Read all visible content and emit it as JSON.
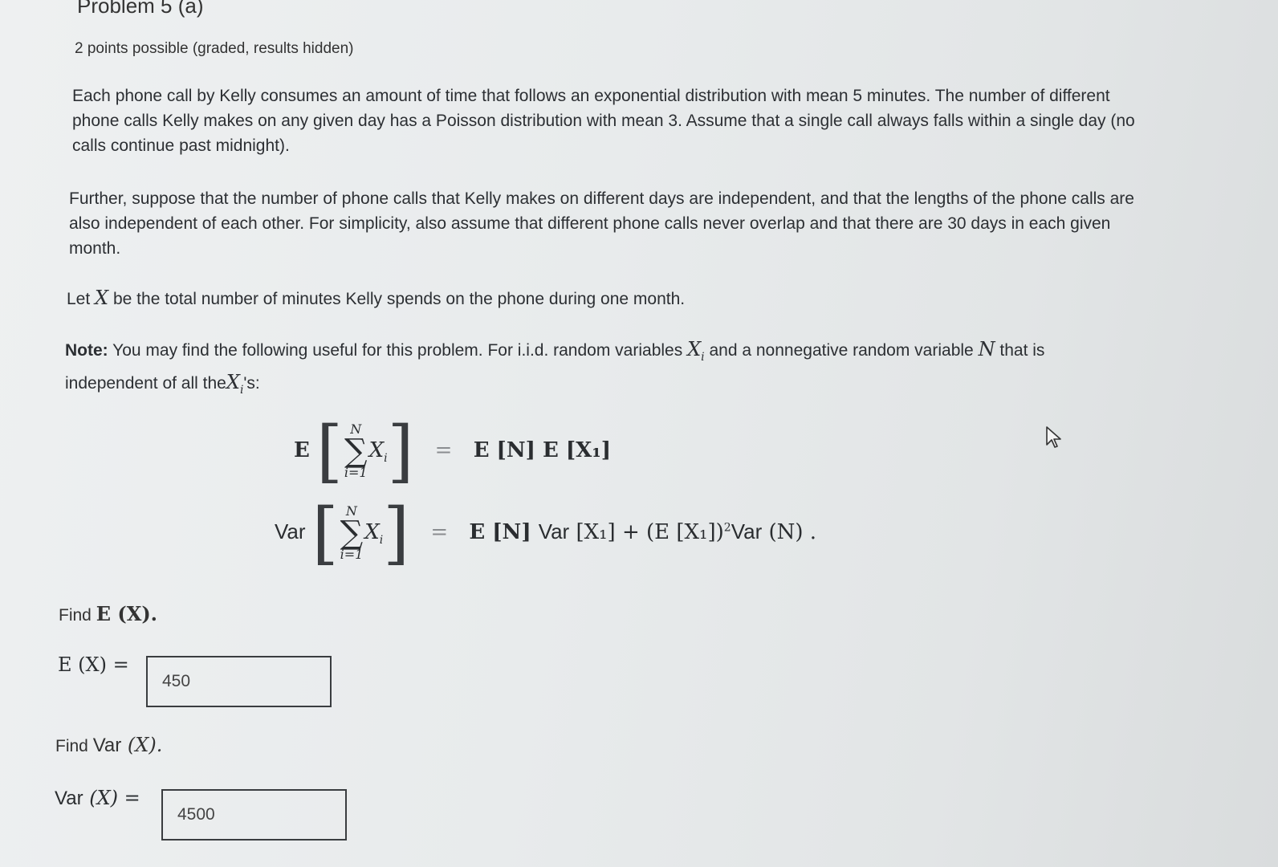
{
  "problem": {
    "title": "Problem 5 (a)",
    "points": "2 points possible (graded, results hidden)"
  },
  "body": {
    "p1": "Each phone call by Kelly consumes an amount of time that follows an exponential distribution with mean 5 minutes. The number of different phone calls Kelly makes on any given day has a Poisson distribution with mean 3. Assume that a single call always falls within a single day (no calls continue past midnight).",
    "p2": "Further, suppose that the number of phone calls that Kelly makes on different days are independent, and that the lengths of the phone calls are also independent of each other. For simplicity, also assume that different phone calls never overlap and that there are 30 days in each given month.",
    "p3_before": "Let",
    "p3_var": "X",
    "p3_after": "be the total number of minutes Kelly spends on the phone during one month.",
    "note_label": "Note:",
    "note_text_1": "You may find the following useful for this problem. For i.i.d. random variables",
    "note_var_1": "X",
    "note_sub_1": "i",
    "note_text_2": "and a nonnegative random variable",
    "note_var_2": "N",
    "note_text_3": "that is independent of all the",
    "note_var_3": "X",
    "note_sub_3": "i",
    "note_text_4": "'s:"
  },
  "formulas": {
    "f1_lhs": "E",
    "sum_upper": "N",
    "sum_lower": "i=1",
    "sum_term": "X",
    "sum_term_sub": "i",
    "eq": "=",
    "f1_rhs": "E [N] E [X₁]",
    "f2_lhs": "Var",
    "f2_rhs_a": "E [N] ",
    "f2_rhs_var": "Var",
    "f2_rhs_b": " [X₁] + (E [X₁])",
    "f2_rhs_sup": "2",
    "f2_rhs_var2": "Var",
    "f2_rhs_c": " (N) ."
  },
  "questions": {
    "q1_find": "Find",
    "q1_expr": "E (X).",
    "q1_label": "E (X) =",
    "q1_value": "450",
    "q2_find": "Find",
    "q2_var": "Var",
    "q2_expr": " (X).",
    "q2_label_var": "Var",
    "q2_label": " (X) =",
    "q2_value": "4500"
  },
  "icons": {
    "cursor": "mouse-pointer-icon"
  }
}
